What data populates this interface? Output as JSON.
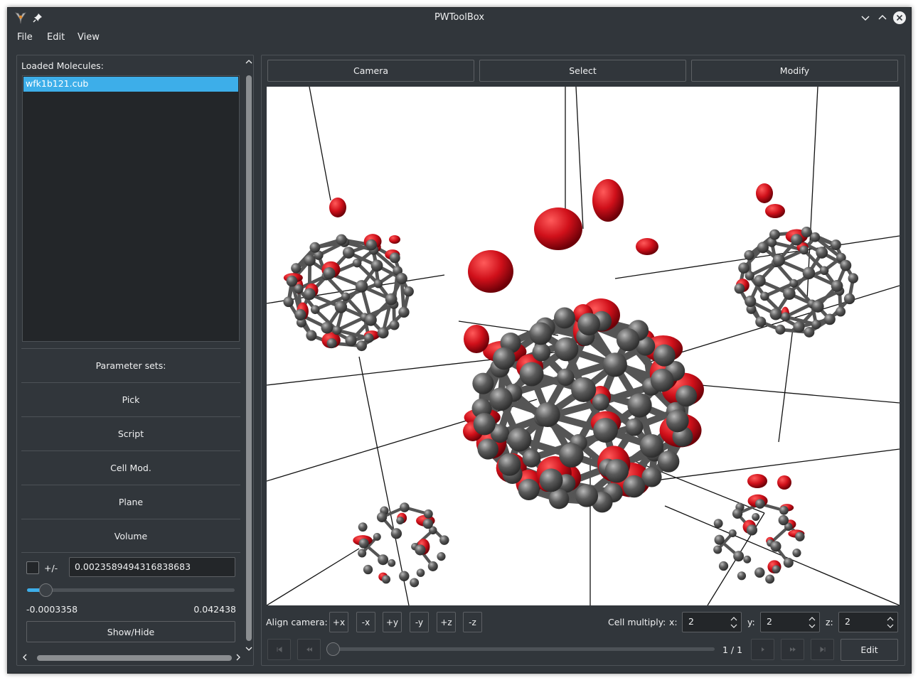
{
  "window": {
    "title": "PWToolBox"
  },
  "menu": {
    "file": "File",
    "edit": "Edit",
    "view": "View"
  },
  "left_dock": {
    "loaded_label": "Loaded Molecules:",
    "molecules": [
      "wfk1b121.cub"
    ],
    "sections": {
      "parameter_sets": "Parameter sets:",
      "pick": "Pick",
      "script": "Script",
      "cell_mod": "Cell Mod.",
      "plane": "Plane",
      "volume": "Volume"
    },
    "volume": {
      "checkbox_checked": false,
      "pm_label": "+/-",
      "isovalue": "0.0023589494316838683",
      "slider_fraction": 0.088,
      "min_label": "-0.0003358",
      "max_label": "0.042438",
      "show_hide": "Show/Hide"
    }
  },
  "tabs": {
    "camera": "Camera",
    "select": "Select",
    "modify": "Modify"
  },
  "viewer": {
    "atom_color": "#5a5a5a",
    "density_color": "#d0101a",
    "background_color": "#ffffff"
  },
  "camera_bar": {
    "align_label": "Align camera:",
    "axes": [
      "+x",
      "-x",
      "+y",
      "-y",
      "+z",
      "-z"
    ],
    "cell_multiply_label": "Cell multiply:",
    "x_label": "x:",
    "x_value": "2",
    "y_label": "y:",
    "y_value": "2",
    "z_label": "z:",
    "z_value": "2"
  },
  "playback": {
    "current": "1",
    "separator": "/",
    "total": "1",
    "edit": "Edit"
  },
  "colors": {
    "accent": "#3daee9",
    "window_bg": "#31363b",
    "input_bg": "#232629"
  }
}
